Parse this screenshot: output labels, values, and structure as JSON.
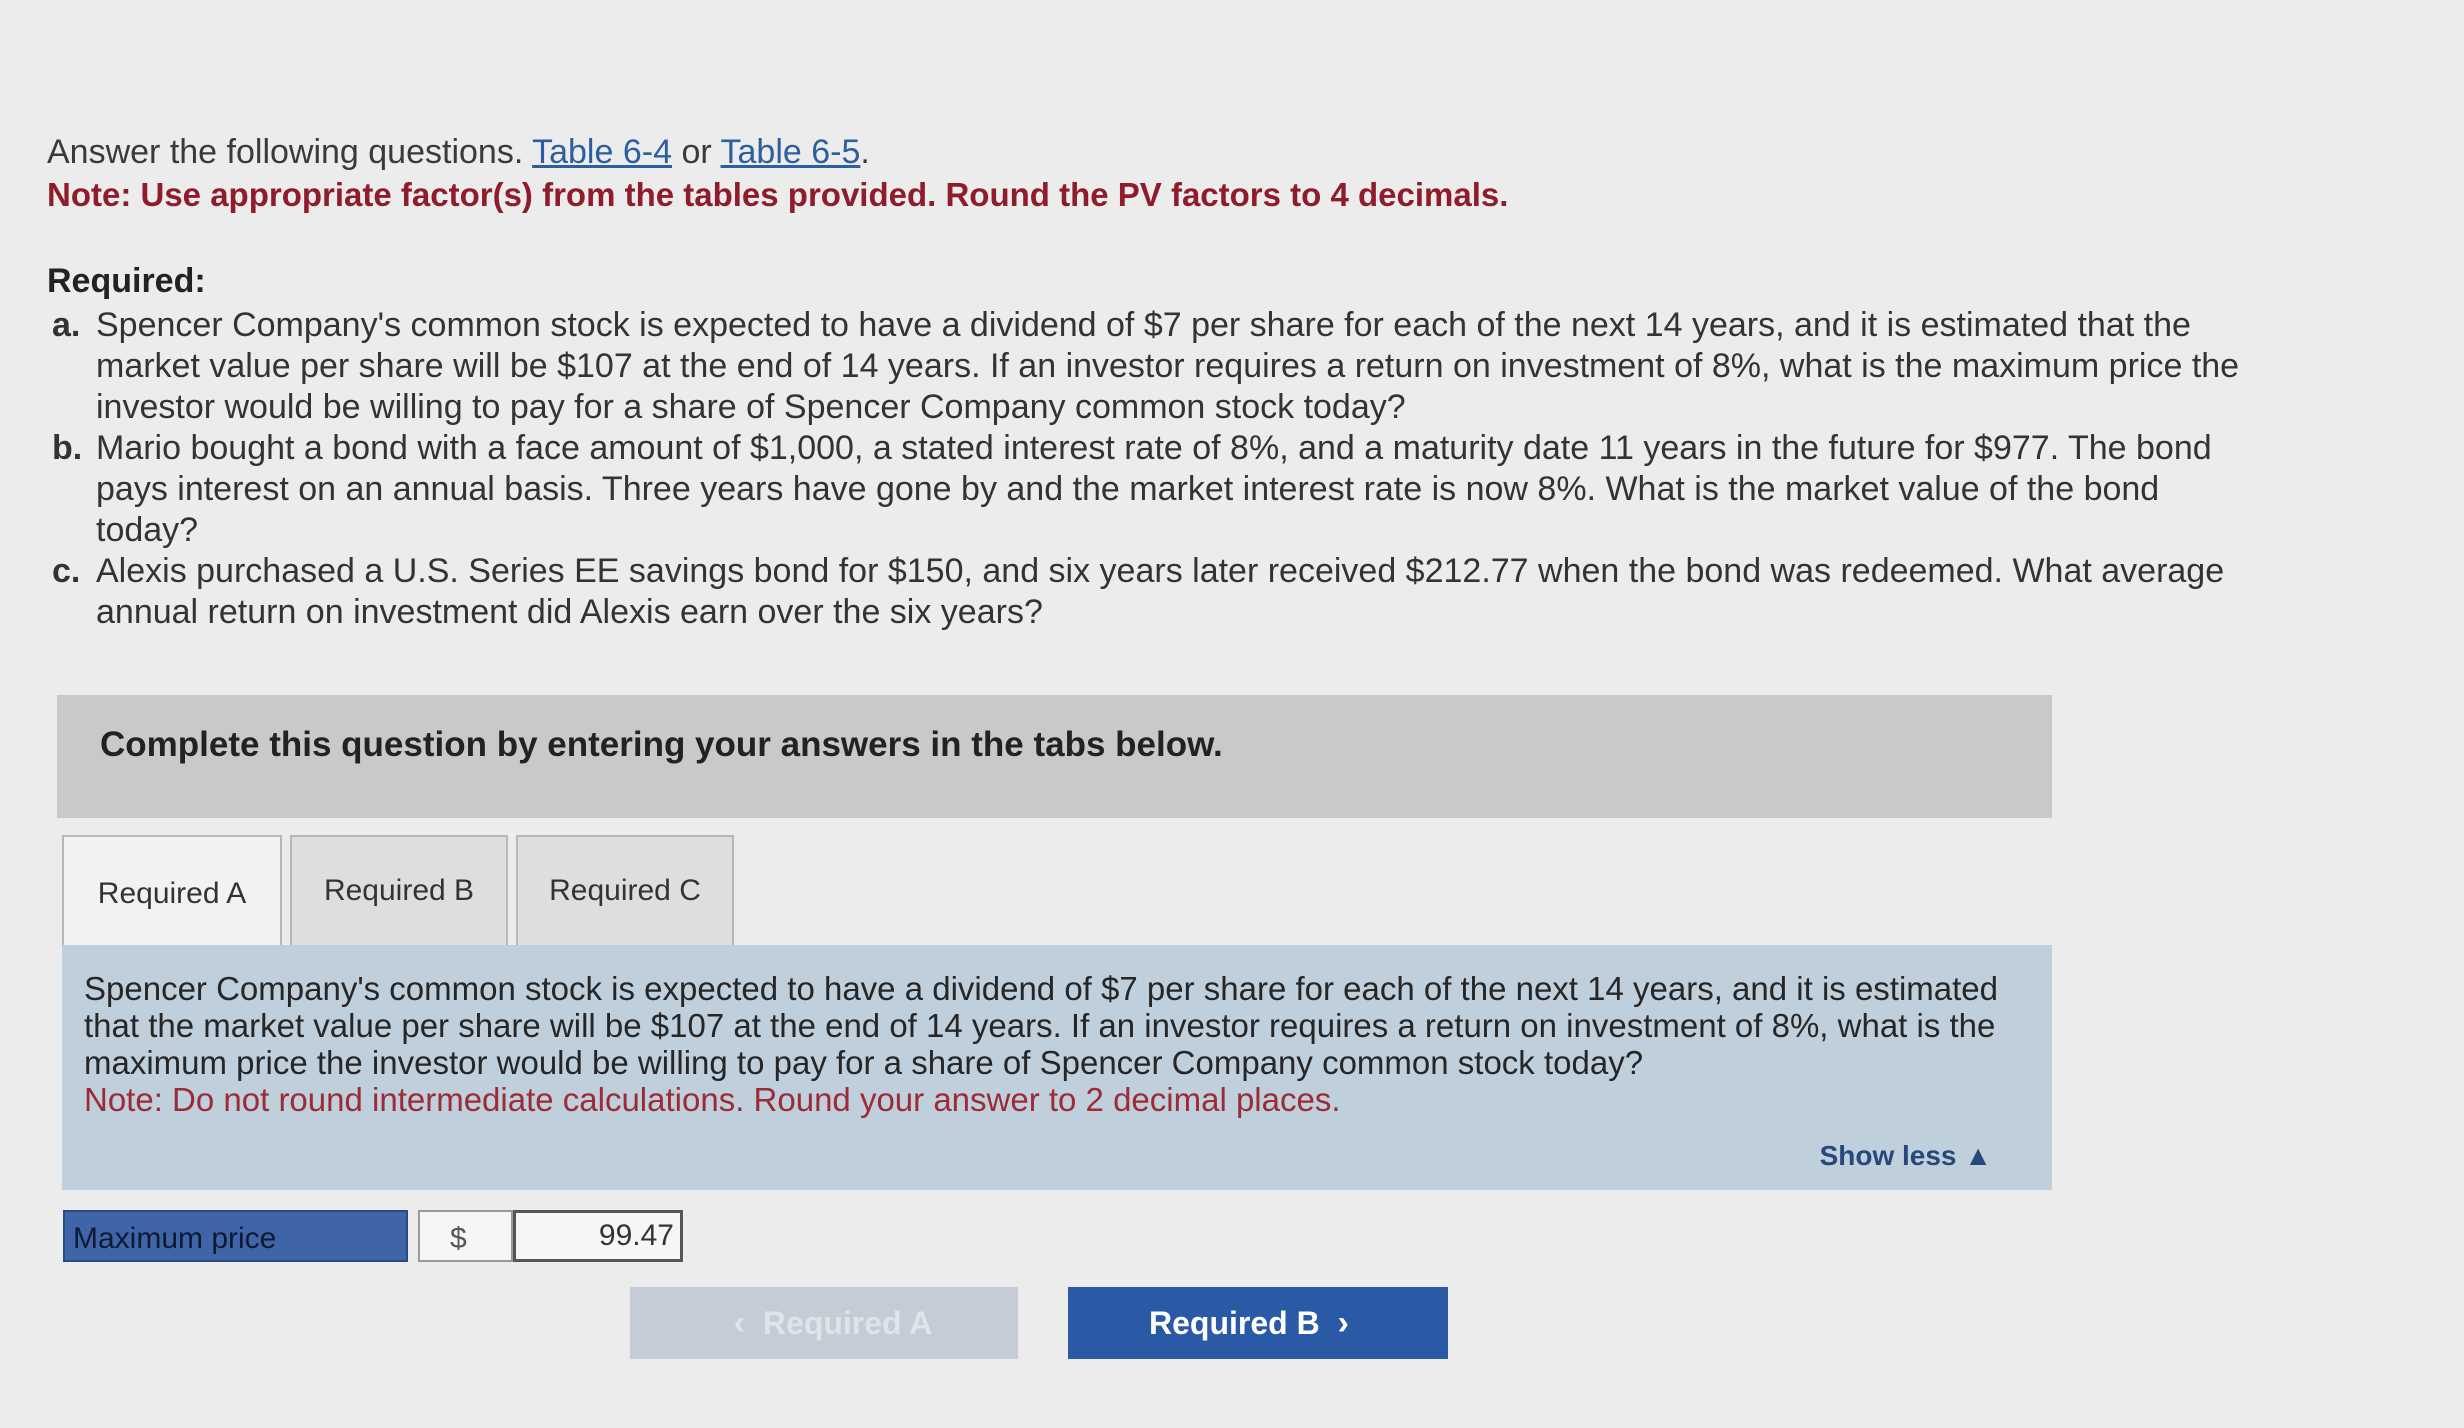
{
  "intro": {
    "text": "Answer the following questions.",
    "link1": "Table 6-4",
    "or": "or",
    "link2": "Table 6-5",
    "period": "."
  },
  "note_top": "Note: Use appropriate factor(s) from the tables provided. Round the PV factors to 4 decimals.",
  "required": {
    "heading": "Required:",
    "items": [
      {
        "letter": "a.",
        "text": "Spencer Company's common stock is expected to have a dividend of $7 per share for each of the next 14 years, and it is estimated that the market value per share will be $107 at the end of 14 years. If an investor requires a return on investment of 8%, what is the maximum price the investor would be willing to pay for a share of Spencer Company common stock today?"
      },
      {
        "letter": "b.",
        "text": "Mario bought a bond with a face amount of $1,000, a stated interest rate of 8%, and a maturity date 11 years in the future for $977. The bond pays interest on an annual basis. Three years have gone by and the market interest rate is now 8%. What is the market value of the bond today?"
      },
      {
        "letter": "c.",
        "text": "Alexis purchased a U.S. Series EE savings bond for $150, and six years later received $212.77 when the bond was redeemed. What average annual return on investment did Alexis earn over the six years?"
      }
    ]
  },
  "complete_bar": "Complete this question by entering your answers in the tabs below.",
  "tabs": [
    {
      "label": "Required A"
    },
    {
      "label": "Required B"
    },
    {
      "label": "Required C"
    }
  ],
  "question": {
    "text": "Spencer Company's common stock is expected to have a dividend of $7 per share for each of the next 14 years, and it is estimated that the market value per share will be $107 at the end of 14 years. If an investor requires a return on investment of 8%, what is the maximum price the investor would be willing to pay for a share of Spencer Company common stock today?",
    "note": "Note: Do not round intermediate calculations. Round your answer to 2 decimal places.",
    "show_less": "Show less ▲"
  },
  "answer": {
    "label": "Maximum price",
    "currency": "$",
    "value": "99.47"
  },
  "nav": {
    "prev_label": "Required A",
    "next_label": "Required B"
  }
}
